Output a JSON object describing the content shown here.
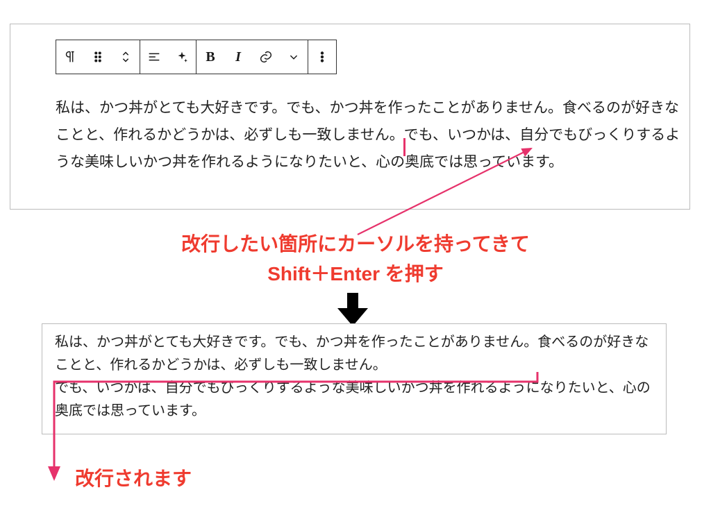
{
  "toolbar": {
    "icons": {
      "paragraph": "pilcrow-icon",
      "drag": "drag-handle-icon",
      "move": "move-updown-icon",
      "align": "align-icon",
      "ai": "sparkle-icon",
      "bold": "B",
      "italic": "I",
      "link": "link-icon",
      "chevron": "chevron-down-icon",
      "more": "more-vertical-icon"
    }
  },
  "editor1": {
    "text_before_cursor": "私は、かつ丼がとても大好きです。でも、かつ丼を作ったことがありません。食べるのが好きなことと、作れるかどうかは、必ずしも一致しません。",
    "text_after_cursor": "でも、いつかは、自分でもびっくりするような美味しいかつ丼を作れるようになりたいと、心の奥底では思っています。"
  },
  "editor2": {
    "line1": "私は、かつ丼がとても大好きです。でも、かつ丼を作ったことがありません。食べるのが好きなことと、作れるかどうかは、必ずしも一致しません。",
    "line2": "でも、いつかは、自分でもびっくりするような美味しいかつ丼を作れるようになりたいと、心の奥底では思っています。"
  },
  "annotations": {
    "main_line1": "改行したい箇所にカーソルを持ってきて",
    "main_line2": "Shift＋Enter を押す",
    "sub": "改行されます"
  },
  "colors": {
    "accent": "#ef3b2f",
    "cursor": "#e6326b",
    "border": "#bbbbbb",
    "toolbar_border": "#333333"
  }
}
